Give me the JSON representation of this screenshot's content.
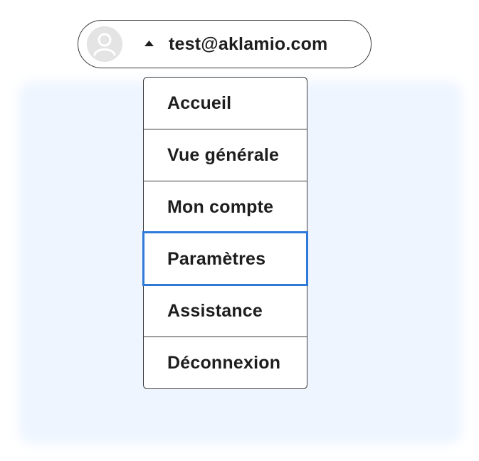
{
  "account": {
    "email": "test@aklamio.com",
    "avatar_icon": "user-avatar-icon",
    "caret_icon": "caret-up-icon",
    "expanded": true
  },
  "menu": {
    "items": [
      {
        "label": "Accueil",
        "active": false
      },
      {
        "label": "Vue générale",
        "active": false
      },
      {
        "label": "Mon compte",
        "active": false
      },
      {
        "label": "Paramètres",
        "active": true
      },
      {
        "label": "Assistance",
        "active": false
      },
      {
        "label": "Déconnexion",
        "active": false
      }
    ]
  },
  "colors": {
    "focus_outline": "#2f7ad8",
    "background_panel": "#eef5ff",
    "text": "#1e1e1e",
    "border": "#3a3a3a",
    "avatar_bg": "#e4e4e4"
  }
}
